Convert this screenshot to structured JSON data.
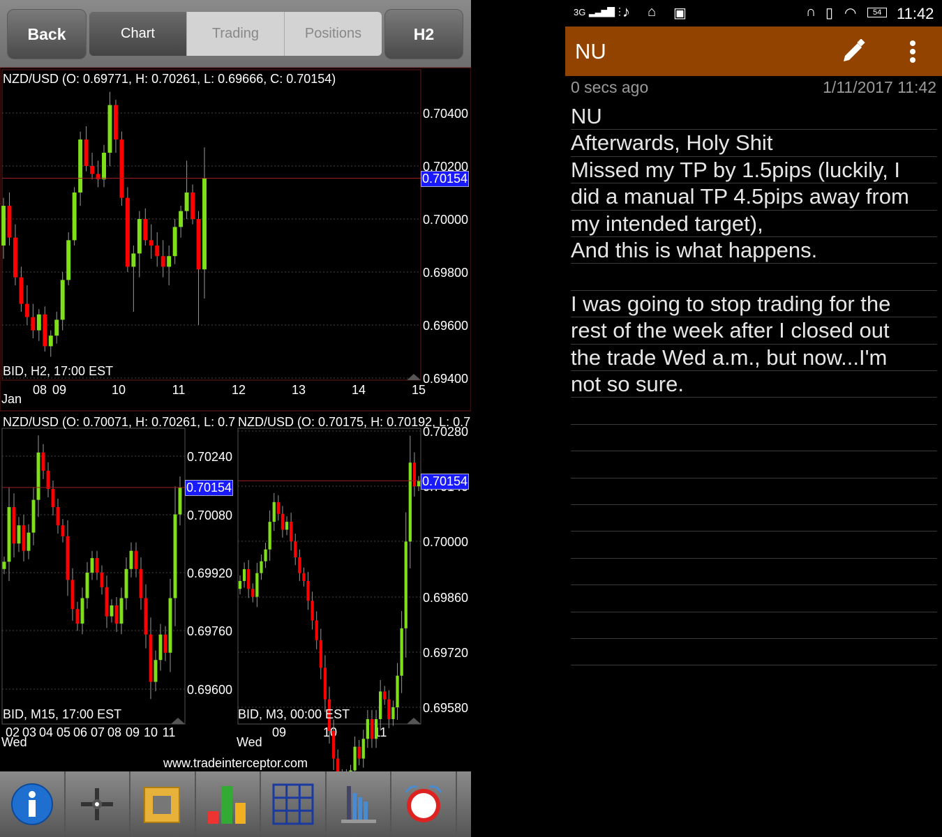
{
  "toolbar": {
    "back": "Back",
    "tabs": [
      "Chart",
      "Trading",
      "Positions"
    ],
    "timeframe": "H2"
  },
  "main_chart": {
    "title": "NZD/USD (O: 0.69771, H: 0.70261, L: 0.69666, C: 0.70154)",
    "footer": "BID, H2, 17:00 EST",
    "month": "Jan",
    "current": "0.70154"
  },
  "left_chart": {
    "title": "NZD/USD (O: 0.70071, H: 0.70261, L: 0.7",
    "footer": "BID, M15, 17:00 EST",
    "day": "Wed",
    "current": "0.70154"
  },
  "right_chart": {
    "title": "NZD/USD (O: 0.70175, H: 0.70192, L: 0.7",
    "footer": "BID, M3, 00:00 EST",
    "day": "Wed",
    "current": "0.70154"
  },
  "website": "www.tradeinterceptor.com",
  "tools": [
    "info-icon",
    "crosshair-icon",
    "ruler-frame-icon",
    "indicators-bar-icon",
    "grid-layout-icon",
    "chart-type-icon",
    "alarm-clock-icon"
  ],
  "colors": {
    "up": "#7fe01a",
    "down": "#ff0000",
    "current_line": "#a02020",
    "note_bar": "#924300",
    "price_label": "#1a1aff"
  },
  "chart_data": [
    {
      "type": "candlestick",
      "name": "NZD/USD H2",
      "ylim": [
        0.694,
        0.7046
      ],
      "yticks": [
        "0.70400",
        "0.70200",
        "0.70000",
        "0.69800",
        "0.69600",
        "0.69400"
      ],
      "xticks": [
        "08",
        "09",
        "10",
        "11",
        "12",
        "13",
        "14",
        "15"
      ],
      "current": 0.70154,
      "ohlc": [
        [
          0.699,
          0.7008,
          0.6985,
          0.7005
        ],
        [
          0.7005,
          0.701,
          0.699,
          0.6993
        ],
        [
          0.6993,
          0.6998,
          0.6975,
          0.6978
        ],
        [
          0.6978,
          0.6982,
          0.6965,
          0.6968
        ],
        [
          0.6968,
          0.6975,
          0.696,
          0.6963
        ],
        [
          0.6963,
          0.6968,
          0.6955,
          0.6958
        ],
        [
          0.6958,
          0.6966,
          0.6954,
          0.6964
        ],
        [
          0.6964,
          0.6967,
          0.695,
          0.6952
        ],
        [
          0.6952,
          0.6958,
          0.6948,
          0.6956
        ],
        [
          0.6956,
          0.6965,
          0.6953,
          0.6962
        ],
        [
          0.6962,
          0.698,
          0.6958,
          0.6977
        ],
        [
          0.6977,
          0.6995,
          0.6975,
          0.6992
        ],
        [
          0.6992,
          0.7012,
          0.699,
          0.701
        ],
        [
          0.701,
          0.7033,
          0.7005,
          0.703
        ],
        [
          0.703,
          0.7035,
          0.7018,
          0.702
        ],
        [
          0.702,
          0.7025,
          0.7015,
          0.7017
        ],
        [
          0.7017,
          0.7022,
          0.7012,
          0.7015
        ],
        [
          0.7015,
          0.7028,
          0.7012,
          0.7025
        ],
        [
          0.7025,
          0.7048,
          0.702,
          0.7043
        ],
        [
          0.7043,
          0.7045,
          0.7025,
          0.703
        ],
        [
          0.703,
          0.7033,
          0.7005,
          0.7008
        ],
        [
          0.7008,
          0.7012,
          0.698,
          0.6982
        ],
        [
          0.6982,
          0.699,
          0.6965,
          0.6987
        ],
        [
          0.6987,
          0.7003,
          0.6978,
          0.7
        ],
        [
          0.7,
          0.7004,
          0.699,
          0.6992
        ],
        [
          0.6992,
          0.6998,
          0.6985,
          0.699
        ],
        [
          0.699,
          0.6995,
          0.6982,
          0.6986
        ],
        [
          0.6986,
          0.6992,
          0.6978,
          0.6982
        ],
        [
          0.6982,
          0.699,
          0.6975,
          0.6986
        ],
        [
          0.6986,
          0.7,
          0.6983,
          0.6997
        ],
        [
          0.6997,
          0.7005,
          0.6993,
          0.7003
        ],
        [
          0.7003,
          0.7022,
          0.7,
          0.701
        ],
        [
          0.701,
          0.7013,
          0.6998,
          0.7
        ],
        [
          0.7,
          0.7003,
          0.696,
          0.6981
        ],
        [
          0.6981,
          0.7027,
          0.697,
          0.70154
        ]
      ]
    },
    {
      "type": "candlestick",
      "name": "NZD/USD M15",
      "ylim": [
        0.6952,
        0.7032
      ],
      "yticks": [
        "0.70240",
        "0.70080",
        "0.69920",
        "0.69760",
        "0.69600"
      ],
      "xticks": [
        "02",
        "03",
        "04",
        "05",
        "06",
        "07",
        "08",
        "09",
        "10",
        "11"
      ],
      "current": 0.70154,
      "closes": [
        0.6995,
        0.701,
        0.7,
        0.7005,
        0.6998,
        0.7003,
        0.7012,
        0.7025,
        0.702,
        0.7015,
        0.701,
        0.7005,
        0.7002,
        0.699,
        0.6982,
        0.6978,
        0.6985,
        0.6992,
        0.6996,
        0.6992,
        0.6988,
        0.698,
        0.6983,
        0.6978,
        0.6985,
        0.6993,
        0.6998,
        0.6993,
        0.6985,
        0.6975,
        0.6962,
        0.6968,
        0.6975,
        0.697,
        0.6985,
        0.7008,
        0.70154
      ]
    },
    {
      "type": "candlestick",
      "name": "NZD/USD M3",
      "ylim": [
        0.6953,
        0.7031
      ],
      "yticks": [
        "0.70280",
        "0.70140",
        "0.70000",
        "0.69860",
        "0.69720",
        "0.69580"
      ],
      "xticks": [
        "09",
        "10",
        "11"
      ],
      "current": 0.70154,
      "closes": [
        0.699,
        0.6993,
        0.6988,
        0.6986,
        0.6992,
        0.6995,
        0.6998,
        0.7005,
        0.701,
        0.7007,
        0.7003,
        0.7005,
        0.7,
        0.6996,
        0.6992,
        0.699,
        0.6985,
        0.698,
        0.6975,
        0.6968,
        0.696,
        0.6952,
        0.6945,
        0.694,
        0.6935,
        0.694,
        0.6942,
        0.6948,
        0.6945,
        0.695,
        0.6955,
        0.695,
        0.6955,
        0.6962,
        0.696,
        0.6955,
        0.6958,
        0.6966,
        0.6978,
        0.7,
        0.702,
        0.7014,
        0.70154
      ]
    }
  ],
  "status": {
    "network": "3G",
    "battery": "54",
    "time": "11:42"
  },
  "note": {
    "title": "NU",
    "age": "0 secs ago",
    "date": "1/11/2017 11:42",
    "lines": [
      "NU",
      "Afterwards, Holy Shit",
      "Missed my TP by 1.5pips (luckily, I",
      "did a manual TP 4.5pips away from",
      "my intended target),",
      "And this is what happens.",
      "",
      "I was going to stop trading for the",
      "rest of the week after I closed out",
      "the trade Wed a.m., but now...I'm",
      "not so sure.",
      "",
      "",
      "",
      "",
      "",
      "",
      "",
      "",
      "",
      ""
    ]
  }
}
